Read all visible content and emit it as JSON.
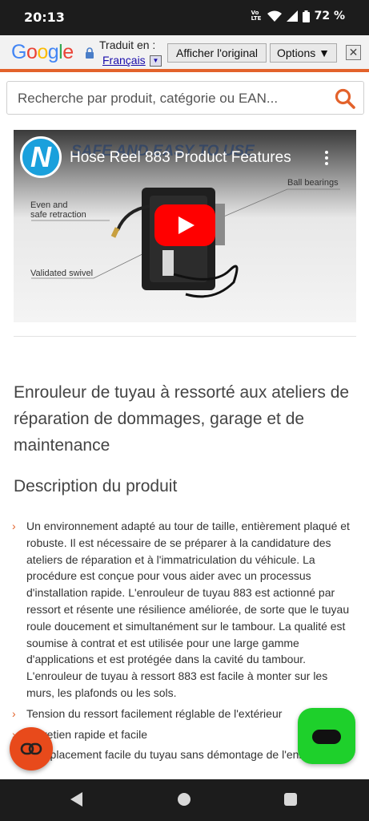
{
  "status_bar": {
    "time": "20:13",
    "volte": "Vo LTE",
    "battery": "72 %"
  },
  "translate_bar": {
    "logo": "Google",
    "translated_to": "Traduit en :",
    "language": "Français",
    "show_original": "Afficher l'original",
    "options": "Options ▼",
    "close": "✕"
  },
  "search": {
    "placeholder": "Recherche par produit, catégorie ou EAN..."
  },
  "video": {
    "title": "Hose Reel 883 Product Features",
    "bg_text": "SAFE AND EASY TO USE",
    "logo_letter": "N",
    "labels": {
      "retraction": "Even and\nsafe retraction",
      "ball_bearings": "Ball bearings",
      "swivel": "Validated swivel"
    }
  },
  "product": {
    "title": "Enrouleur de tuyau à ressorté aux ateliers de réparation de dommages, garage et de maintenance",
    "description_heading": "Description du produit",
    "bullets": [
      "Un environnement adapté au tour de taille, entièrement plaqué et robuste. Il est nécessaire de se préparer à la candidature des ateliers de réparation et à l'immatriculation du véhicule. La procédure est conçue pour vous aider avec un processus d'installation rapide. L'enrouleur de tuyau 883 est actionné par ressort et résente une résilience améliorée, de sorte que le tuyau roule doucement et simultanément sur le tambour. La qualité est soumise à contrat et est utilisée pour une large gamme d'applications et est protégée dans la cavité du tambour. L'enrouleur de tuyau à ressort 883 est facile à monter sur les murs, les plafonds ou les sols.",
      "Tension du ressort facilement réglable de l'extérieur",
      "Entretien rapide et facile",
      "Remplacement facile du tuyau sans démontage de l'enrouleur"
    ]
  },
  "colors": {
    "accent": "#e3622b",
    "chat_green": "#1ed02b",
    "youtube_red": "#ff0000"
  },
  "icons": [
    "lock-icon",
    "search-icon",
    "more-vert-icon",
    "play-icon",
    "chevron-right-icon",
    "chat-link-icon",
    "message-icon",
    "back-icon",
    "home-icon",
    "recents-icon"
  ]
}
